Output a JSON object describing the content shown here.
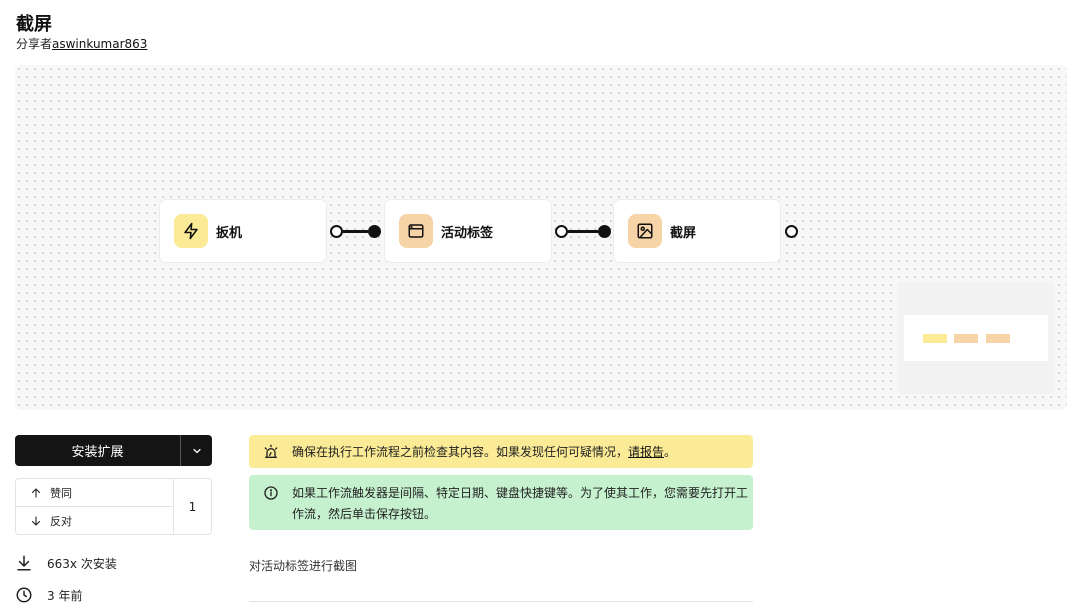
{
  "header": {
    "title": "截屏",
    "shared_by_prefix": "分享者",
    "author": "aswinkumar863"
  },
  "workflow": {
    "nodes": [
      {
        "label": "扳机",
        "icon": "lightning-icon",
        "color": "#fbeb96"
      },
      {
        "label": "活动标签",
        "icon": "browser-window-icon",
        "color": "#f7d4a8"
      },
      {
        "label": "截屏",
        "icon": "image-icon",
        "color": "#f7d4a8"
      }
    ]
  },
  "sidebar": {
    "install_label": "安装扩展",
    "upvote_label": "赞同",
    "downvote_label": "反对",
    "vote_count": "1",
    "installs": "663x 次安装",
    "age": "3 年前"
  },
  "alerts": {
    "warning_text": "确保在执行工作流程之前检查其内容。如果发现任何可疑情况，",
    "warning_link": "请报告",
    "warning_suffix": "。",
    "info_text": "如果工作流触发器是间隔、特定日期、键盘快捷键等。为了使其工作，您需要先打开工作流，然后单击保存按钮。"
  },
  "description": "对活动标签进行截图",
  "colors": {
    "install_button": "#141414",
    "warning_bg": "#fbeb96",
    "info_bg": "#c6f1cf",
    "canvas_bg": "#f7f7f7"
  }
}
